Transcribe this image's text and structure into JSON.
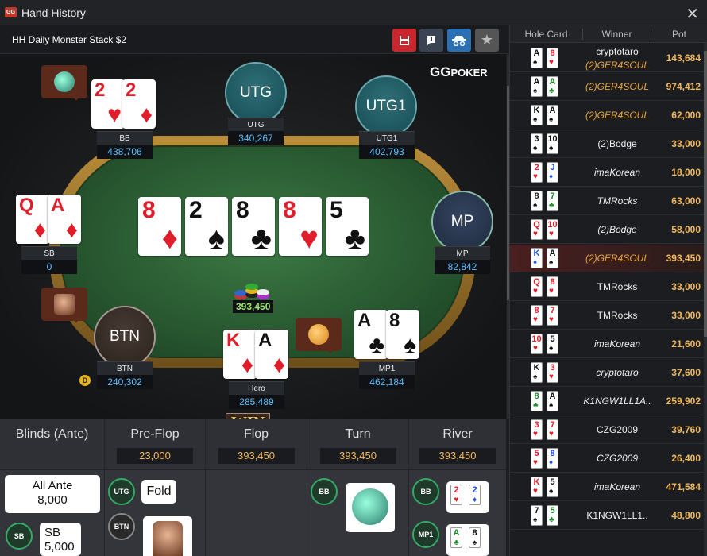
{
  "window": {
    "title": "Hand History",
    "close": "✕",
    "logo": "GG"
  },
  "header": {
    "label": "HH  Daily Monster Stack $2"
  },
  "brand": {
    "logo": "GG",
    "sub": "POKER"
  },
  "seats": {
    "bb": {
      "pos": "BB",
      "stack": "438,706"
    },
    "utg": {
      "pos": "UTG",
      "stack": "340,267",
      "avatar": "UTG"
    },
    "utg1": {
      "pos": "UTG1",
      "stack": "402,793",
      "avatar": "UTG1"
    },
    "sb": {
      "pos": "SB",
      "stack": "0"
    },
    "mp": {
      "pos": "MP",
      "stack": "82,842",
      "avatar": "MP"
    },
    "btn": {
      "pos": "BTN",
      "stack": "240,302",
      "avatar": "BTN"
    },
    "hero": {
      "pos": "Hero",
      "stack": "285,489"
    },
    "mp1": {
      "pos": "MP1",
      "stack": "462,184"
    }
  },
  "cards": {
    "bb": [
      {
        "rank": "2",
        "suit": "♥"
      },
      {
        "rank": "2",
        "suit": "♦"
      }
    ],
    "sb": [
      {
        "rank": "Q",
        "suit": "♦"
      },
      {
        "rank": "A",
        "suit": "♦"
      }
    ],
    "hero": [
      {
        "rank": "K",
        "suit": "♦"
      },
      {
        "rank": "A",
        "suit": "♦"
      }
    ],
    "mp1": [
      {
        "rank": "A",
        "suit": "♣"
      },
      {
        "rank": "8",
        "suit": "♠"
      }
    ],
    "board": [
      {
        "rank": "8",
        "suit": "♦"
      },
      {
        "rank": "2",
        "suit": "♠"
      },
      {
        "rank": "8",
        "suit": "♣"
      },
      {
        "rank": "8",
        "suit": "♥"
      },
      {
        "rank": "5",
        "suit": "♣"
      }
    ]
  },
  "pot": "393,450",
  "dealer": "D",
  "win_label": "WIN",
  "streets": [
    {
      "name": "Blinds (Ante)",
      "value": ""
    },
    {
      "name": "Pre-Flop",
      "value": "23,000"
    },
    {
      "name": "Flop",
      "value": "393,450"
    },
    {
      "name": "Turn",
      "value": "393,450"
    },
    {
      "name": "River",
      "value": "393,450"
    }
  ],
  "actions": {
    "ante": "All Ante\n8,000",
    "sb_badge": "SB",
    "sb_text": "SB\n5,000",
    "utg_badge": "UTG",
    "utg_text": "Fold",
    "btn_badge": "BTN",
    "bb_badge": "BB",
    "river_bb_badge": "BB",
    "river_bb_cards": [
      {
        "rank": "2",
        "suit": "♥"
      },
      {
        "rank": "2",
        "suit": "♦"
      }
    ],
    "river_mp1_badge": "MP1",
    "river_mp1_cards": [
      {
        "rank": "A",
        "suit": "♣"
      },
      {
        "rank": "8",
        "suit": "♠"
      }
    ]
  },
  "history": {
    "headers": [
      "Hole Card",
      "Winner",
      "Pot"
    ],
    "rows": [
      {
        "c1": [
          "A",
          "♠"
        ],
        "c2": [
          "8",
          "♥"
        ],
        "w": "cryptotaro",
        "w2": "(2)GER4SOUL",
        "p": "143,684",
        "style": "two"
      },
      {
        "c1": [
          "A",
          "♠"
        ],
        "c2": [
          "A",
          "♣"
        ],
        "w": "(2)GER4SOUL",
        "p": "974,412",
        "style": "or"
      },
      {
        "c1": [
          "K",
          "♠"
        ],
        "c2": [
          "A",
          "♠"
        ],
        "w": "(2)GER4SOUL",
        "p": "62,000",
        "style": "or"
      },
      {
        "c1": [
          "3",
          "♠"
        ],
        "c2": [
          "10",
          "♠"
        ],
        "w": "(2)Bodge",
        "p": "33,000",
        "style": ""
      },
      {
        "c1": [
          "2",
          "♥"
        ],
        "c2": [
          "J",
          "♦"
        ],
        "w": "imaKorean",
        "p": "18,000",
        "style": "it"
      },
      {
        "c1": [
          "8",
          "♠"
        ],
        "c2": [
          "7",
          "♣"
        ],
        "w": "TMRocks",
        "p": "63,000",
        "style": "it"
      },
      {
        "c1": [
          "Q",
          "♥"
        ],
        "c2": [
          "10",
          "♥"
        ],
        "w": "(2)Bodge",
        "p": "58,000",
        "style": "it"
      },
      {
        "c1": [
          "K",
          "♦"
        ],
        "c2": [
          "A",
          "♠"
        ],
        "w": "(2)GER4SOUL",
        "p": "393,450",
        "style": "or",
        "hl": true
      },
      {
        "c1": [
          "Q",
          "♥"
        ],
        "c2": [
          "8",
          "♥"
        ],
        "w": "TMRocks",
        "p": "33,000",
        "style": ""
      },
      {
        "c1": [
          "8",
          "♥"
        ],
        "c2": [
          "7",
          "♥"
        ],
        "w": "TMRocks",
        "p": "33,000",
        "style": ""
      },
      {
        "c1": [
          "10",
          "♥"
        ],
        "c2": [
          "5",
          "♠"
        ],
        "w": "imaKorean",
        "p": "21,600",
        "style": "it"
      },
      {
        "c1": [
          "K",
          "♠"
        ],
        "c2": [
          "3",
          "♥"
        ],
        "w": "cryptotaro",
        "p": "37,600",
        "style": "it"
      },
      {
        "c1": [
          "8",
          "♣"
        ],
        "c2": [
          "A",
          "♠"
        ],
        "w": "K1NGW1LL1A..",
        "p": "259,902",
        "style": "it"
      },
      {
        "c1": [
          "3",
          "♥"
        ],
        "c2": [
          "7",
          "♥"
        ],
        "w": "CZG2009",
        "p": "39,760",
        "style": ""
      },
      {
        "c1": [
          "5",
          "♥"
        ],
        "c2": [
          "8",
          "♦"
        ],
        "w": "CZG2009",
        "p": "26,400",
        "style": "it"
      },
      {
        "c1": [
          "K",
          "♥"
        ],
        "c2": [
          "5",
          "♠"
        ],
        "w": "imaKorean",
        "p": "471,584",
        "style": "it"
      },
      {
        "c1": [
          "7",
          "♠"
        ],
        "c2": [
          "5",
          "♣"
        ],
        "w": "K1NGW1LL1..",
        "p": "48,800",
        "style": ""
      }
    ]
  },
  "colors": {
    "accent": "#5bc0ff",
    "pot": "#9be36c",
    "amount": "#f0b85a",
    "winner": "#e6a33a"
  }
}
